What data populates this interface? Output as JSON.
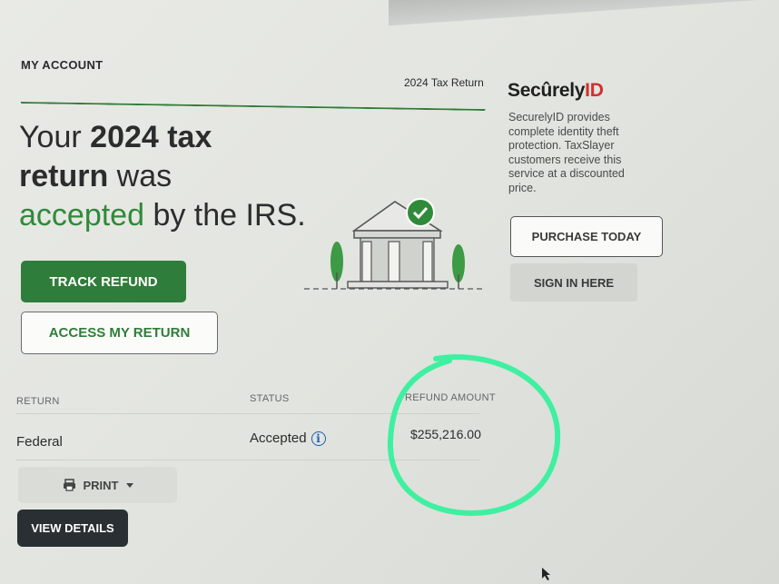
{
  "header": {
    "account_title": "MY ACCOUNT",
    "return_title": "2024 Tax Return"
  },
  "hero": {
    "line1_plain": "Your ",
    "line1_bold": "2024 tax",
    "line2_bold": "return",
    "line2_plain": " was",
    "line3_green": "accepted",
    "line3_plain": " by the IRS."
  },
  "buttons": {
    "track_refund": "TRACK REFUND",
    "access_return": "ACCESS MY RETURN",
    "print": "PRINT",
    "view_details": "VIEW DETAILS"
  },
  "securely": {
    "logo_main": "Secûrely",
    "logo_id": "ID",
    "description": "SecurelyID provides complete identity theft protection. TaxSlayer customers receive this service at a discounted price.",
    "purchase": "PURCHASE TODAY",
    "sign_in": "SIGN IN HERE"
  },
  "table": {
    "headers": [
      "RETURN",
      "STATUS",
      "REFUND AMOUNT"
    ],
    "rows": [
      {
        "return": "Federal",
        "status": "Accepted",
        "refund": "$255,216.00"
      }
    ]
  },
  "colors": {
    "brand_green": "#2f7d3a",
    "highlight_circle": "#3ef0a0",
    "logo_red": "#d42f2f",
    "info_blue": "#1d5fae"
  },
  "icons": [
    "info-icon",
    "printer-icon",
    "caret-down-icon",
    "check-icon",
    "bank-icon",
    "cursor-icon"
  ]
}
